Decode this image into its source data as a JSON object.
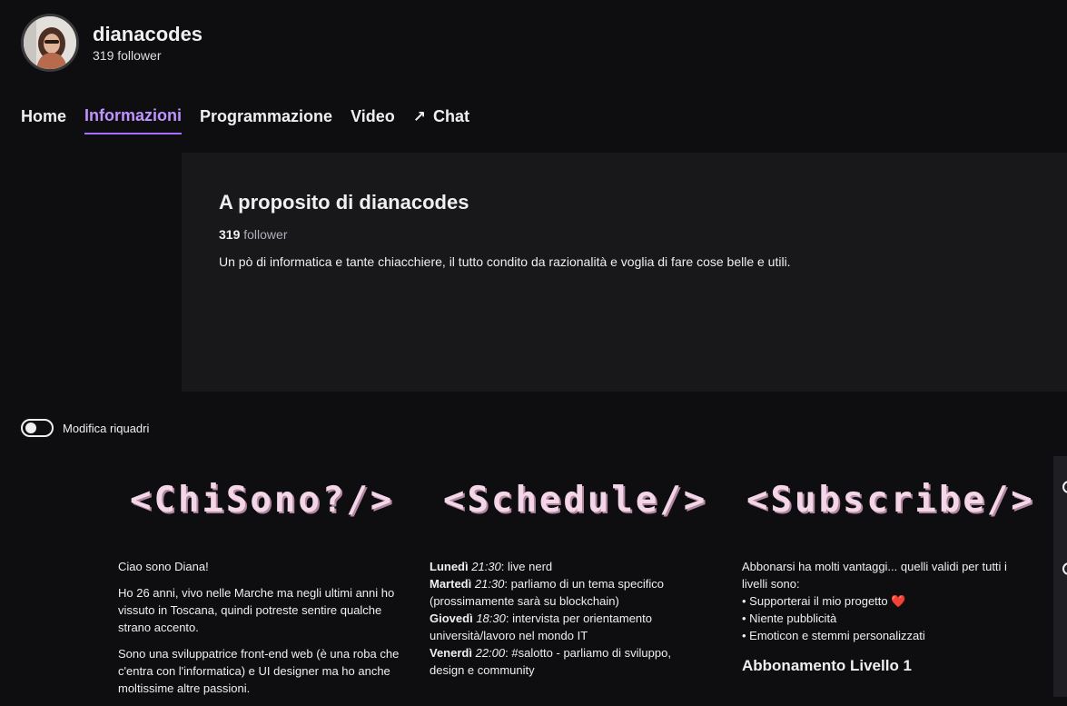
{
  "channel": {
    "name": "dianacodes",
    "followers": "319 follower"
  },
  "tabs": [
    {
      "label": "Home",
      "active": false
    },
    {
      "label": "Informazioni",
      "active": true
    },
    {
      "label": "Programmazione",
      "active": false
    },
    {
      "label": "Video",
      "active": false
    },
    {
      "label": "Chat",
      "active": false,
      "icon": "external-arrow-icon"
    }
  ],
  "about": {
    "title": "A proposito di dianacodes",
    "follower_count": "319",
    "follower_label": "follower",
    "description": "Un pò di informatica e tante chiacchiere, il tutto condito da razionalità e voglia di fare cose belle e utili."
  },
  "toggle": {
    "label": "Modifica riquadri",
    "on": false
  },
  "panels": {
    "chisono": {
      "title": "<ChiSono?/>",
      "p1": "Ciao sono Diana!",
      "p2": "Ho 26 anni, vivo nelle Marche ma negli ultimi anni ho vissuto in Toscana, quindi potreste sentire qualche strano accento.",
      "p3": "Sono una sviluppatrice front-end web (è una roba che c'entra con l'informatica) e UI designer ma ho anche moltissime altre passioni."
    },
    "schedule": {
      "title": "<Schedule/>",
      "items": [
        {
          "day": "Lunedì",
          "time": "21:30",
          "desc": ": live nerd"
        },
        {
          "day": "Martedì",
          "time": "21:30",
          "desc": ": parliamo di un tema specifico (prossimamente sarà su blockchain)"
        },
        {
          "day": "Giovedì",
          "time": "18:30",
          "desc": ": intervista per orientamento università/lavoro nel mondo IT"
        },
        {
          "day": "Venerdì",
          "time": "22:00",
          "desc": ": #salotto - parliamo di sviluppo, design e community"
        }
      ]
    },
    "subscribe": {
      "title": "<Subscribe/>",
      "intro": "Abbonarsi ha molti vantaggi... quelli validi per tutti i livelli sono:",
      "bullets": [
        "• Supporterai il mio progetto",
        "• Niente pubblicità",
        "• Emoticon e stemmi personalizzati"
      ],
      "heart": "❤️",
      "level_heading": "Abbonamento Livello 1"
    }
  },
  "colors": {
    "accent": "#a970ff",
    "background": "#0e0e10",
    "card": "#18181b",
    "panel_title": "#f3d6e8"
  }
}
